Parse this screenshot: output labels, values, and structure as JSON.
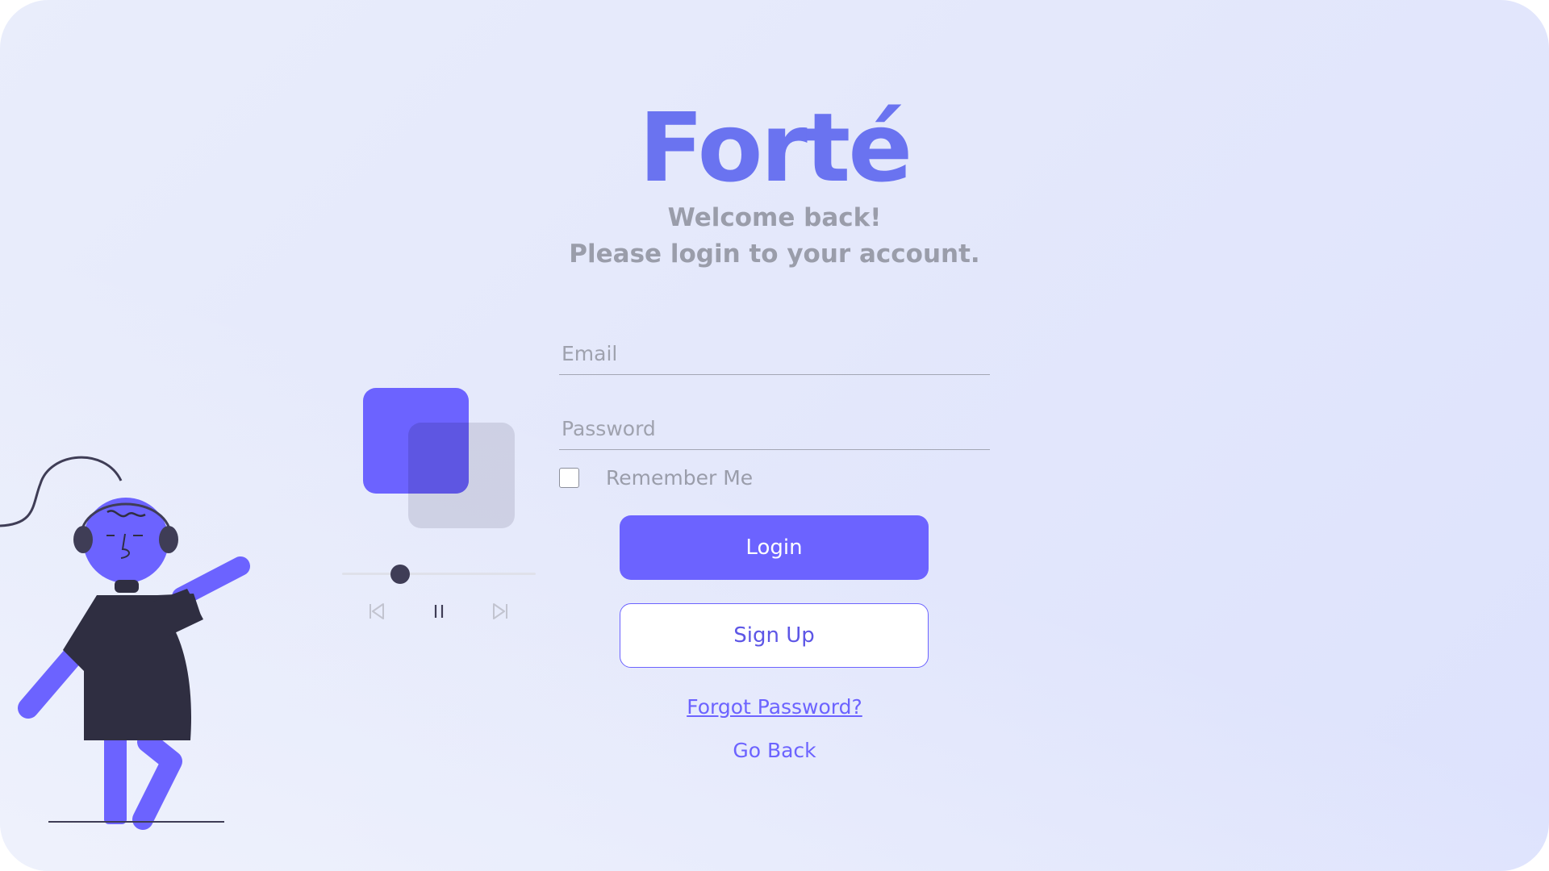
{
  "brand": {
    "title": "Forté",
    "color": "#6a73f0"
  },
  "welcome": {
    "line1": "Welcome back!",
    "line2": "Please login to your account."
  },
  "form": {
    "email_placeholder": "Email",
    "email_value": "",
    "password_placeholder": "Password",
    "password_value": "",
    "remember_label": "Remember Me",
    "remember_checked": false
  },
  "buttons": {
    "login": "Login",
    "signup": "Sign Up"
  },
  "links": {
    "forgot": "Forgot Password?",
    "back": "Go Back"
  },
  "player": {
    "progress": 0.3,
    "state": "playing",
    "icons": [
      "previous-icon",
      "pause-icon",
      "next-icon"
    ]
  },
  "colors": {
    "accent": "#6c63ff",
    "dark": "#3f3d56",
    "muted_text": "#9a9daa"
  }
}
